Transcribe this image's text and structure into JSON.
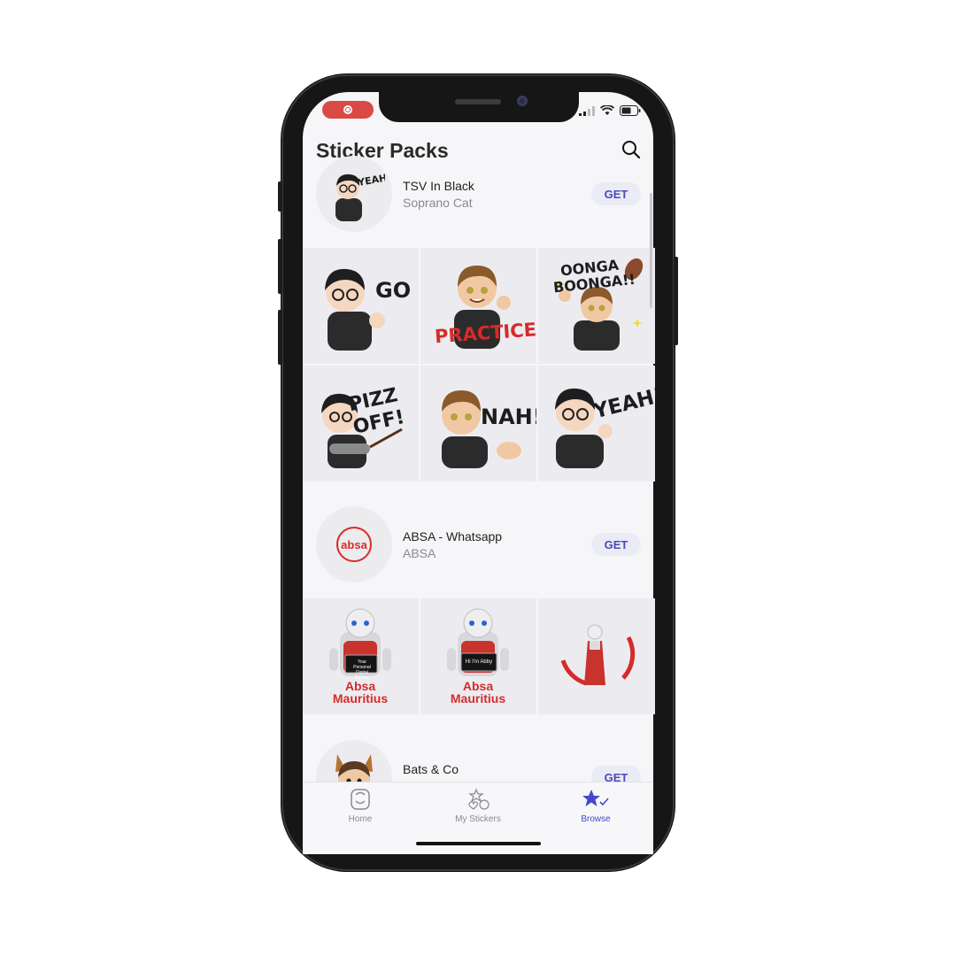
{
  "status_bar": {
    "recording": true,
    "icons": [
      "signal-icon",
      "wifi-icon",
      "battery-icon"
    ]
  },
  "header": {
    "title": "Sticker Packs",
    "search_icon": "search-icon"
  },
  "packs": [
    {
      "name": "TSV In Black",
      "author": "Soprano Cat",
      "get_label": "GET",
      "avatar_text": "YEAH!",
      "stickers": [
        {
          "text": "GO"
        },
        {
          "text": "PRACTICE!"
        },
        {
          "text": "OONGA BOONGA!!"
        },
        {
          "text": "PIZZ OFF!"
        },
        {
          "text": "NAH!"
        },
        {
          "text": "YEAH!"
        }
      ]
    },
    {
      "name": "ABSA - Whatsapp",
      "author": "ABSA",
      "get_label": "GET",
      "avatar_text": "absa",
      "stickers": [
        {
          "text": "Absa Mauritius",
          "screen": "Your Personal Digital Banker"
        },
        {
          "text": "Absa Mauritius",
          "screen": "Hi I'm Abby"
        },
        {
          "text": ""
        }
      ]
    },
    {
      "name": "Bats & Co",
      "author": "",
      "get_label": "GET"
    }
  ],
  "tabs": [
    {
      "label": "Home",
      "icon": "sticker-face-icon",
      "active": false
    },
    {
      "label": "My Stickers",
      "icon": "my-stickers-icon",
      "active": false
    },
    {
      "label": "Browse",
      "icon": "star-check-icon",
      "active": true
    }
  ],
  "colors": {
    "accent": "#4747c8",
    "absa_red": "#d62b2b",
    "rec": "#d94a45"
  }
}
